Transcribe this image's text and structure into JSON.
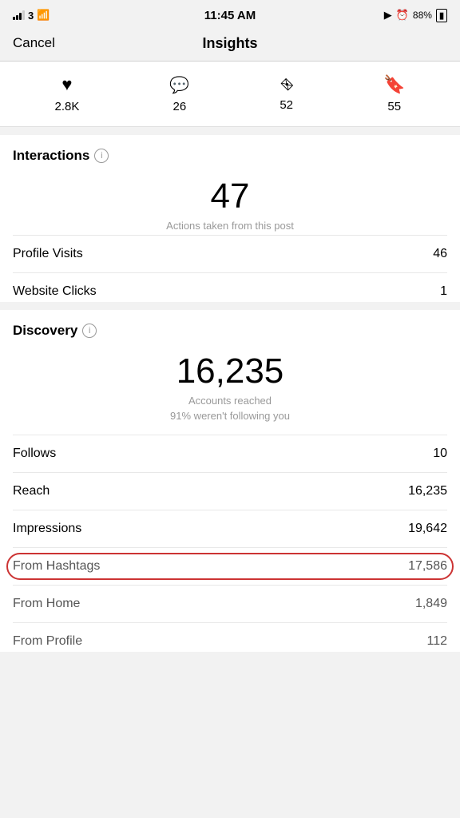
{
  "statusBar": {
    "carrier": "3",
    "time": "11:45 AM",
    "location": "▶",
    "alarm": "⏰",
    "battery": "88%"
  },
  "navBar": {
    "cancelLabel": "Cancel",
    "title": "Insights"
  },
  "statsRow": [
    {
      "icon": "♥",
      "value": "2.8K",
      "iconName": "heart-icon"
    },
    {
      "icon": "💬",
      "value": "26",
      "iconName": "comment-icon"
    },
    {
      "icon": "✈",
      "value": "52",
      "iconName": "share-icon"
    },
    {
      "icon": "🔖",
      "value": "55",
      "iconName": "bookmark-icon"
    }
  ],
  "interactions": {
    "sectionTitle": "Interactions",
    "bigNumber": "47",
    "subLabel": "Actions taken from this post",
    "rows": [
      {
        "label": "Profile Visits",
        "value": "46"
      },
      {
        "label": "Website Clicks",
        "value": "1"
      }
    ]
  },
  "discovery": {
    "sectionTitle": "Discovery",
    "bigNumber": "16,235",
    "subLabel": "Accounts reached",
    "subLabel2": "91% weren't following you",
    "rows": [
      {
        "label": "Follows",
        "value": "10",
        "light": false
      },
      {
        "label": "Reach",
        "value": "16,235",
        "light": false
      },
      {
        "label": "Impressions",
        "value": "19,642",
        "light": false
      },
      {
        "label": "From Hashtags",
        "value": "17,586",
        "light": true,
        "highlighted": true
      },
      {
        "label": "From Home",
        "value": "1,849",
        "light": true
      },
      {
        "label": "From Profile",
        "value": "112",
        "light": true
      }
    ]
  }
}
